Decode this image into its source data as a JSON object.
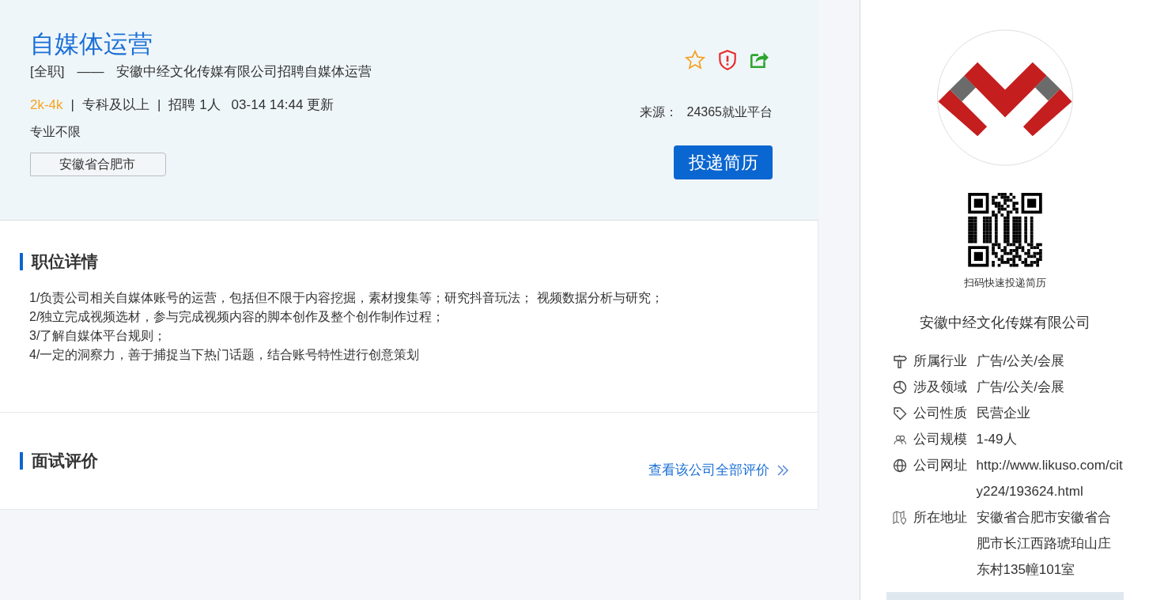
{
  "job": {
    "title": "自媒体运营",
    "type": "[全职]",
    "dash": "——",
    "headline": "安徽中经文化传媒有限公司招聘自媒体运营",
    "salary": "2k-4k",
    "separator": "|",
    "meta": [
      "专科及以上",
      "招聘 1人"
    ],
    "updated": "03-14 14:44 更新",
    "major": "专业不限",
    "location_tag": "安徽省合肥市",
    "source_label": "来源：",
    "source": "24365就业平台",
    "apply_button": "投递简历"
  },
  "sections": [
    {
      "kind": "details",
      "title": "职位详情",
      "lines": [
        "1/负责公司相关自媒体账号的运营，包括但不限于内容挖掘，素材搜集等；研究抖音玩法； 视频数据分析与研究；",
        "2/独立完成视频选材，参与完成视频内容的脚本创作及整个创作制作过程；",
        "3/了解自媒体平台规则；",
        "4/一定的洞察力，善于捕捉当下热门话题，结合账号特性进行创意策划"
      ]
    },
    {
      "kind": "reviews",
      "title": "面试评价",
      "link": "查看该公司全部评价"
    }
  ],
  "company": {
    "qr_caption": "扫码快速投递简历",
    "name": "安徽中经文化传媒有限公司",
    "info": [
      {
        "kind": "industry",
        "label": "所属行业",
        "value": "广告/公关/会展"
      },
      {
        "kind": "field",
        "label": "涉及领域",
        "value": "广告/公关/会展"
      },
      {
        "kind": "nature",
        "label": "公司性质",
        "value": "民营企业"
      },
      {
        "kind": "size",
        "label": "公司规模",
        "value": "1-49人"
      },
      {
        "kind": "website",
        "label": "公司网址",
        "value": "http://www.likuso.com/city224/193624.html"
      },
      {
        "kind": "address",
        "label": "所在地址",
        "value": "安徽省合肥市安徽省合肥市长江西路琥珀山庄东村135幢101室"
      }
    ]
  }
}
